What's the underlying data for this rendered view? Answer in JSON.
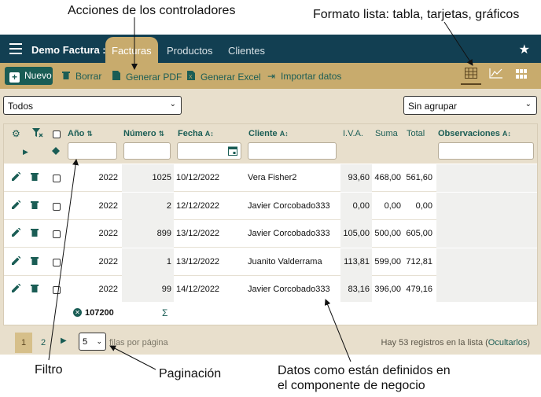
{
  "annotations": {
    "actions": "Acciones de los controladores",
    "format": "Formato lista: tabla, tarjetas, gráficos",
    "filter": "Filtro",
    "pagination": "Paginación",
    "data_line1": "Datos como están definidos en",
    "data_line2": "el componente de negocio"
  },
  "app": {
    "title": "Demo Factura :",
    "tabs": [
      "Facturas",
      "Productos",
      "Clientes"
    ],
    "active_tab": "Facturas"
  },
  "toolbar": {
    "new": "Nuevo",
    "delete": "Borrar",
    "pdf": "Generar PDF",
    "excel": "Generar Excel",
    "import": "Importar datos"
  },
  "filters": {
    "condition": "Todos",
    "grouping": "Sin agrupar"
  },
  "columns": {
    "year": "Año",
    "number": "Número",
    "date": "Fecha",
    "client": "Cliente",
    "vat": "I.V.A.",
    "sum": "Suma",
    "total": "Total",
    "notes": "Observaciones"
  },
  "rows": [
    {
      "year": "2022",
      "number": "1025",
      "date": "10/12/2022",
      "client": "Vera Fisher2",
      "vat": "93,60",
      "sum": "468,00",
      "total": "561,60"
    },
    {
      "year": "2022",
      "number": "2",
      "date": "12/12/2022",
      "client": "Javier Corcobado333",
      "vat": "0,00",
      "sum": "0,00",
      "total": "0,00"
    },
    {
      "year": "2022",
      "number": "899",
      "date": "13/12/2022",
      "client": "Javier Corcobado333",
      "vat": "105,00",
      "sum": "500,00",
      "total": "605,00"
    },
    {
      "year": "2022",
      "number": "1",
      "date": "13/12/2022",
      "client": "Juanito Valderrama",
      "vat": "113,81",
      "sum": "599,00",
      "total": "712,81"
    },
    {
      "year": "2022",
      "number": "99",
      "date": "14/12/2022",
      "client": "Javier Corcobado333",
      "vat": "83,16",
      "sum": "396,00",
      "total": "479,16"
    }
  ],
  "footer": {
    "year_total": "107200",
    "sigma": "Σ"
  },
  "pagination": {
    "current_page": "1",
    "next_page": "2",
    "page_size": "5",
    "page_size_label": "filas por página",
    "records_text": "Hay 53 registros en la lista (",
    "records_link": "Ocultarlos",
    "records_close": ")"
  },
  "icons": {
    "menu": "hamburger-icon",
    "star": "star-icon",
    "edit": "pencil-icon",
    "remove": "trash-icon",
    "sort": "sort-az-icon",
    "calendar": "calendar-icon"
  },
  "colors": {
    "topbar": "#123f52",
    "toolbar": "#c8ab6d",
    "accent": "#1a5d55",
    "background": "#e8dfcc"
  }
}
